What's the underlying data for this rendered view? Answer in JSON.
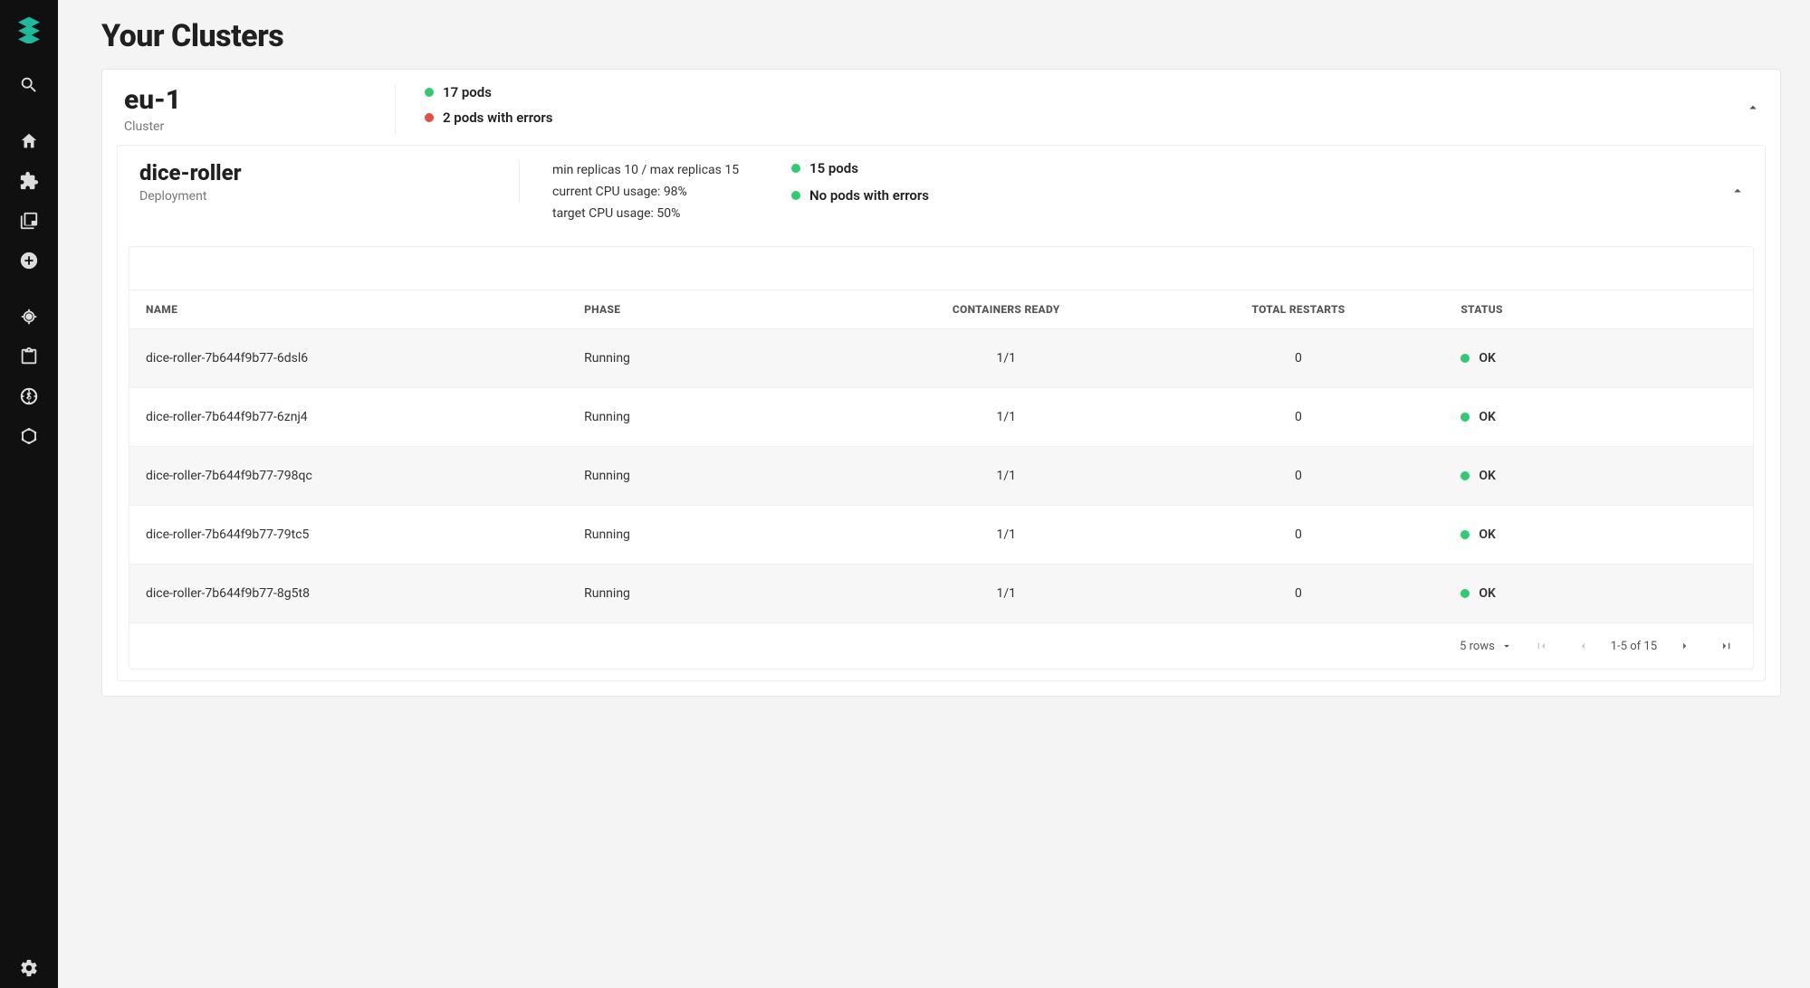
{
  "page": {
    "title": "Your Clusters"
  },
  "cluster": {
    "name": "eu-1",
    "label": "Cluster",
    "status": {
      "pods_ok": "17 pods",
      "pods_err": "2 pods with errors"
    }
  },
  "deployment": {
    "name": "dice-roller",
    "label": "Deployment",
    "details": {
      "replicas": "min replicas 10 / max replicas 15",
      "current_cpu": "current CPU usage: 98%",
      "target_cpu": "target CPU usage: 50%"
    },
    "status": {
      "pods_ok": "15 pods",
      "pods_err": "No pods with errors"
    }
  },
  "table": {
    "headers": {
      "name": "NAME",
      "phase": "PHASE",
      "containers_ready": "CONTAINERS READY",
      "total_restarts": "TOTAL RESTARTS",
      "status": "STATUS"
    },
    "rows": [
      {
        "name": "dice-roller-7b644f9b77-6dsl6",
        "phase": "Running",
        "containers_ready": "1/1",
        "total_restarts": "0",
        "status": "OK"
      },
      {
        "name": "dice-roller-7b644f9b77-6znj4",
        "phase": "Running",
        "containers_ready": "1/1",
        "total_restarts": "0",
        "status": "OK"
      },
      {
        "name": "dice-roller-7b644f9b77-798qc",
        "phase": "Running",
        "containers_ready": "1/1",
        "total_restarts": "0",
        "status": "OK"
      },
      {
        "name": "dice-roller-7b644f9b77-79tc5",
        "phase": "Running",
        "containers_ready": "1/1",
        "total_restarts": "0",
        "status": "OK"
      },
      {
        "name": "dice-roller-7b644f9b77-8g5t8",
        "phase": "Running",
        "containers_ready": "1/1",
        "total_restarts": "0",
        "status": "OK"
      }
    ]
  },
  "pagination": {
    "rows_label": "5 rows",
    "range_label": "1-5 of 15"
  },
  "colors": {
    "ok": "#2ecc71",
    "err": "#e74c3c",
    "brand": "#1abc9c"
  }
}
